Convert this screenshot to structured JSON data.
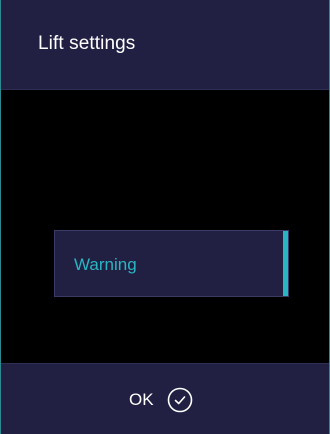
{
  "header": {
    "title": "Lift settings"
  },
  "menu": {
    "items": [
      {
        "label": "Warning",
        "selected": true
      }
    ]
  },
  "footer": {
    "ok_label": "OK",
    "ok_icon": "check-circle-icon"
  },
  "colors": {
    "background": "#000000",
    "panel": "#212043",
    "accent": "#29b5c2",
    "text": "#ffffff"
  }
}
